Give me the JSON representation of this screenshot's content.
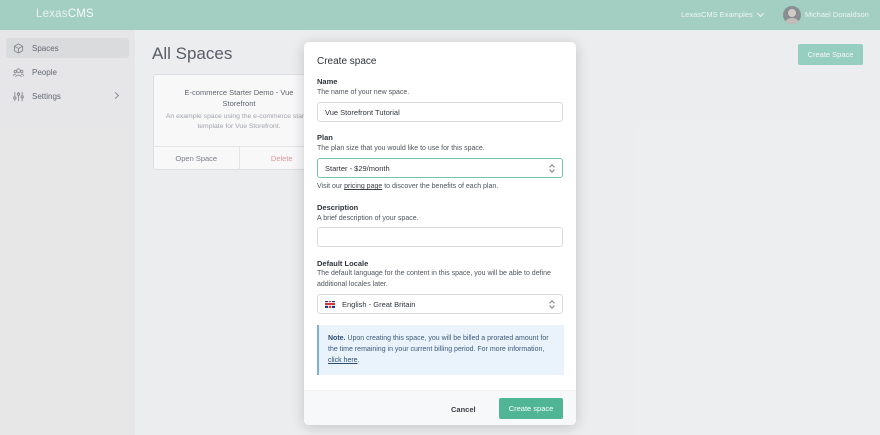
{
  "app": {
    "logo_light": "Lexas",
    "logo_bold": "CMS",
    "workspace": "LexasCMS Examples",
    "user_name": "Michael Donaldson",
    "accent": "#a8d5c8"
  },
  "sidebar": {
    "items": [
      {
        "label": "Spaces",
        "icon": "cube-icon"
      },
      {
        "label": "People",
        "icon": "people-icon"
      },
      {
        "label": "Settings",
        "icon": "sliders-icon"
      }
    ]
  },
  "main": {
    "title": "All Spaces",
    "create_label": "Create Space",
    "card": {
      "title": "E-commerce Starter Demo - Vue Storefront",
      "description": "An example space using the e-commerce starter template for Vue Storefront.",
      "open_label": "Open Space",
      "delete_label": "Delete"
    }
  },
  "modal": {
    "title": "Create space",
    "name": {
      "label": "Name",
      "help": "The name of your new space.",
      "value": "Vue Storefront Tutorial"
    },
    "plan": {
      "label": "Plan",
      "help": "The plan size that you would like to use for this space.",
      "selected": "Starter - $29/month",
      "hint_before": "Visit our ",
      "hint_link": "pricing page",
      "hint_after": " to discover the benefits of each plan."
    },
    "description": {
      "label": "Description",
      "help": "A brief description of your space.",
      "value": ""
    },
    "locale": {
      "label": "Default Locale",
      "help": "The default language for the content in this space, you will be able to define additional locales later.",
      "selected": "English - Great Britain",
      "flag_icon": "uk-flag-icon"
    },
    "note": {
      "title": "Note.",
      "text": " Upon creating this space, you will be billed a prorated amount for the time remaining in your current billing period. For more information, ",
      "link": "click here",
      "end": "."
    },
    "cancel_label": "Cancel",
    "create_label": "Create space",
    "primary_color": "#4fb594"
  }
}
